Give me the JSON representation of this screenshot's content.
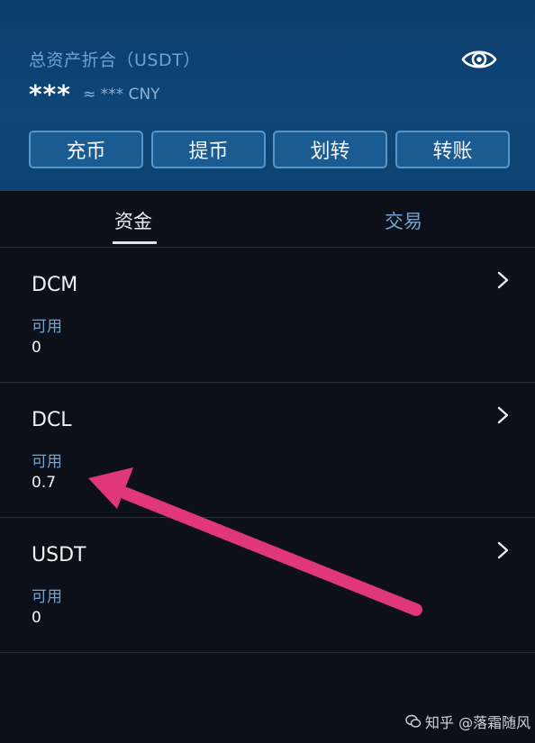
{
  "header": {
    "total_label": "总资产折合（USDT）",
    "total_value": "***",
    "total_cny": "≈ *** CNY",
    "eye_icon": "eye-icon"
  },
  "actions": {
    "deposit": "充币",
    "withdraw": "提币",
    "transfer": "划转",
    "send": "转账"
  },
  "tabs": {
    "funds": "资金",
    "trade": "交易"
  },
  "assets": [
    {
      "name": "DCM",
      "available_label": "可用",
      "available": "0"
    },
    {
      "name": "DCL",
      "available_label": "可用",
      "available": "0.7"
    },
    {
      "name": "USDT",
      "available_label": "可用",
      "available": "0"
    }
  ],
  "annotation": {
    "color": "#e0377a",
    "icon": "arrow-annotation"
  },
  "watermark": {
    "text": "知乎 @落霜随风",
    "icon": "wechat-icon"
  },
  "colors": {
    "header_bg": "#0d4677",
    "page_bg": "#0e1019",
    "accent_text": "#6fa4cf",
    "button_bg": "#1a5c92",
    "button_border": "#5b95c7"
  }
}
